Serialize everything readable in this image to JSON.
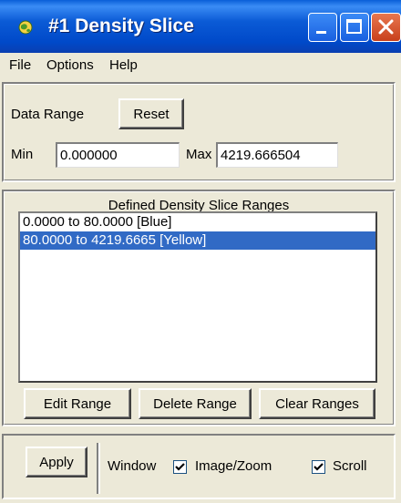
{
  "window": {
    "title": "#1 Density Slice"
  },
  "menu": {
    "items": [
      "File",
      "Options",
      "Help"
    ]
  },
  "data_range": {
    "label": "Data Range",
    "reset_label": "Reset",
    "min_label": "Min",
    "min_value": "0.000000",
    "max_label": "Max",
    "max_value": "4219.666504"
  },
  "ranges": {
    "title": "Defined Density Slice Ranges",
    "items": [
      {
        "text": "0.0000 to 80.0000 [Blue]",
        "selected": false
      },
      {
        "text": "80.0000 to 4219.6665 [Yellow]",
        "selected": true
      }
    ],
    "edit_label": "Edit Range",
    "delete_label": "Delete Range",
    "clear_label": "Clear Ranges"
  },
  "apply": {
    "apply_label": "Apply",
    "window_label": "Window",
    "image_zoom_label": "Image/Zoom",
    "image_zoom_checked": true,
    "scroll_label": "Scroll",
    "scroll_checked": true
  },
  "colors": {
    "titlebar": "#0a5fd8",
    "selection": "#316ac5",
    "face": "#ece9d8",
    "close": "#c8401c"
  }
}
